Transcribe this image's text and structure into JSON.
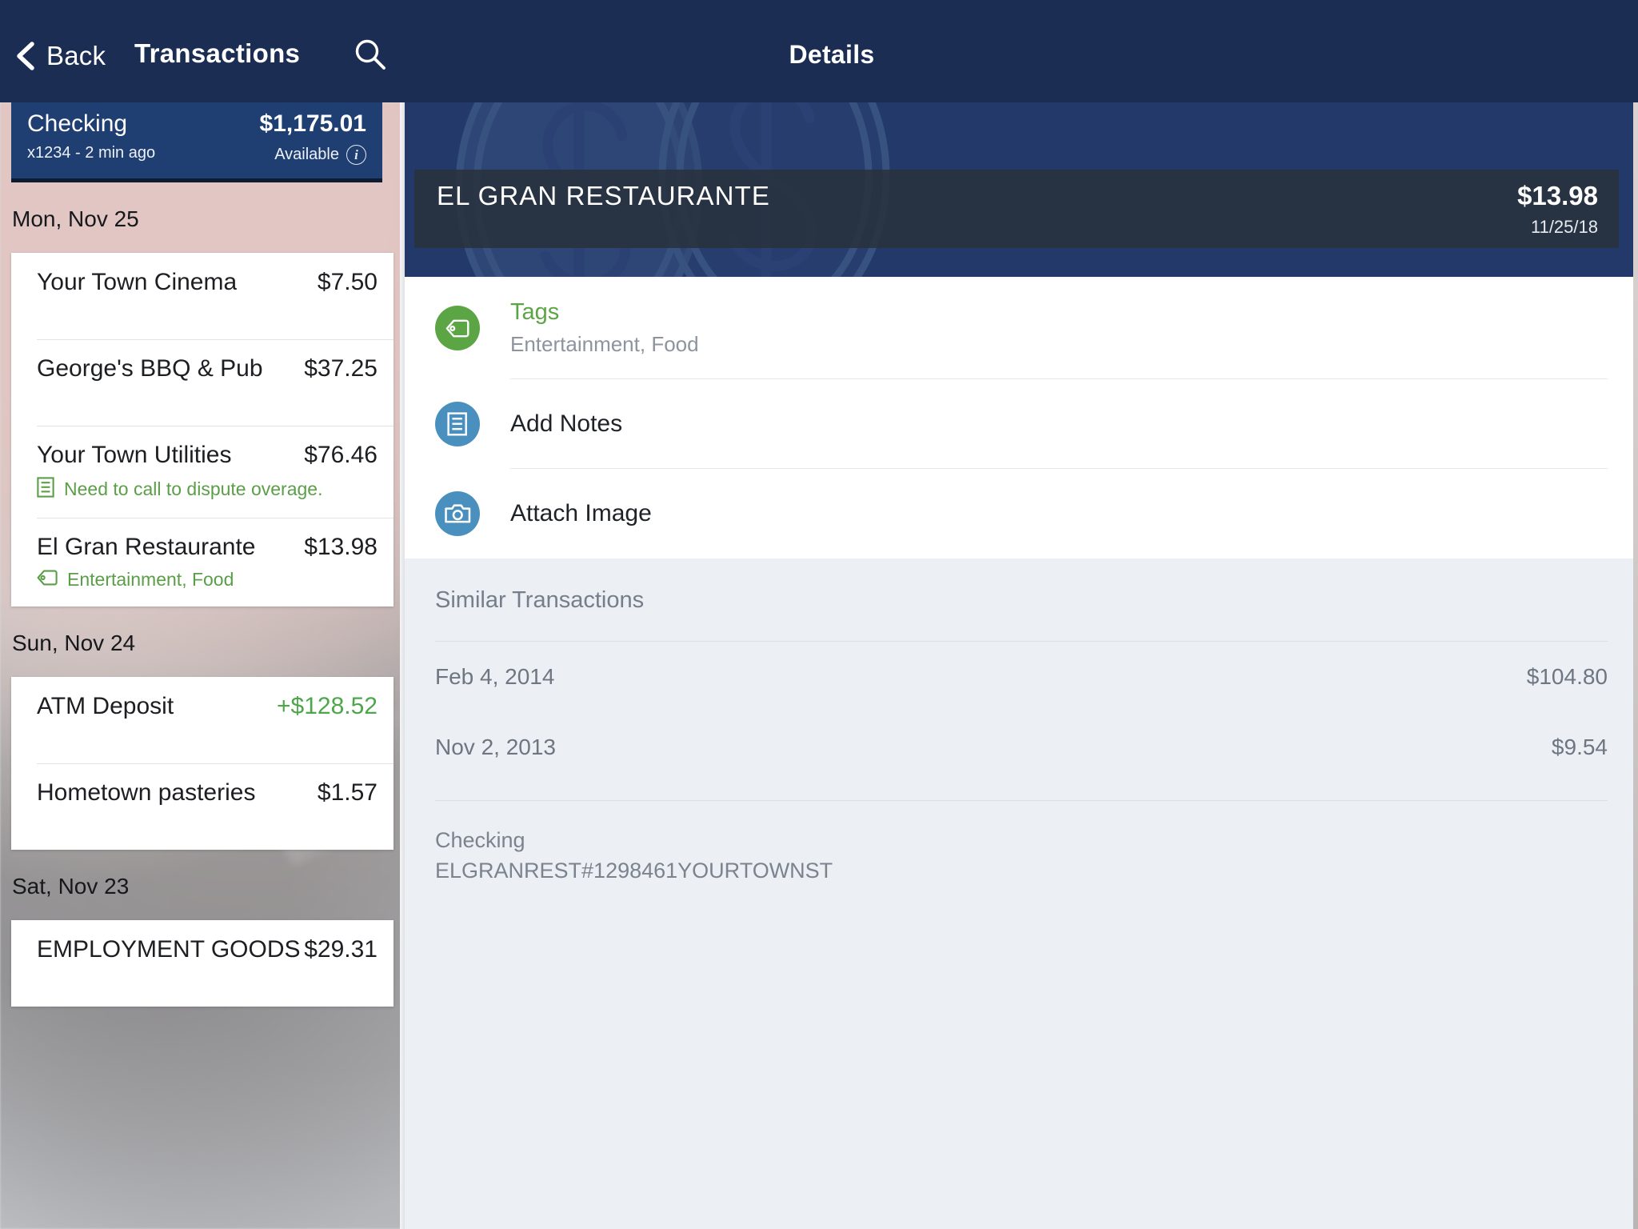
{
  "navbar": {
    "back_label": "Back",
    "left_title": "Transactions",
    "right_title": "Details",
    "back_icon": "chevron-left-icon",
    "search_icon": "search-icon"
  },
  "account": {
    "name": "Checking",
    "balance": "$1,175.01",
    "subtitle": "x1234 - 2 min ago",
    "available_label": "Available",
    "info_icon": "info-icon",
    "info_glyph": "i",
    "accent": "#1f3e72"
  },
  "transaction_groups": [
    {
      "day": "Mon, Nov 25",
      "rows": [
        {
          "name": "Your Town Cinema",
          "amount": "$7.50",
          "credit": false,
          "meta_icon": "",
          "meta_text": ""
        },
        {
          "name": "George's BBQ & Pub",
          "amount": "$37.25",
          "credit": false,
          "meta_icon": "",
          "meta_text": ""
        },
        {
          "name": "Your Town Utilities",
          "amount": "$76.46",
          "credit": false,
          "meta_icon": "note-icon",
          "meta_text": "Need to call to dispute overage."
        },
        {
          "name": "El Gran Restaurante",
          "amount": "$13.98",
          "credit": false,
          "meta_icon": "tag-icon",
          "meta_text": "Entertainment, Food"
        }
      ]
    },
    {
      "day": "Sun, Nov 24",
      "rows": [
        {
          "name": "ATM Deposit",
          "amount": "+$128.52",
          "credit": true,
          "meta_icon": "",
          "meta_text": ""
        },
        {
          "name": "Hometown pasteries",
          "amount": "$1.57",
          "credit": false,
          "meta_icon": "",
          "meta_text": ""
        }
      ]
    },
    {
      "day": "Sat, Nov 23",
      "rows": [
        {
          "name": "EMPLOYMENT GOODS O...",
          "amount": "$29.31",
          "credit": false,
          "meta_icon": "",
          "meta_text": ""
        }
      ]
    }
  ],
  "detail": {
    "payee": "EL GRAN RESTAURANTE",
    "amount": "$13.98",
    "date": "11/25/18",
    "hero_watermark_icon": "dollar-cent-watermark-icon",
    "actions": [
      {
        "icon": "tag-icon",
        "icon_color": "#5ca545",
        "title": "Tags",
        "title_green": true,
        "subtitle": "Entertainment, Food"
      },
      {
        "icon": "note-icon",
        "icon_color": "#4a90bf",
        "title": "Add Notes",
        "title_green": false,
        "subtitle": ""
      },
      {
        "icon": "camera-icon",
        "icon_color": "#4a90bf",
        "title": "Attach Image",
        "title_green": false,
        "subtitle": ""
      }
    ],
    "similar": {
      "title": "Similar Transactions",
      "rows": [
        {
          "date": "Feb 4, 2014",
          "amount": "$104.80"
        },
        {
          "date": "Nov 2, 2013",
          "amount": "$9.54"
        }
      ]
    },
    "memo": {
      "account": "Checking",
      "descriptor": "ELGRANREST#1298461YOURTOWNST"
    }
  },
  "colors": {
    "nav_blue": "#1b2d52",
    "hero_blue": "#22396a",
    "hero_bar": "#283b4d",
    "green": "#5ca545",
    "blue_icon": "#4a90bf",
    "credit_green": "#4ea64b"
  }
}
